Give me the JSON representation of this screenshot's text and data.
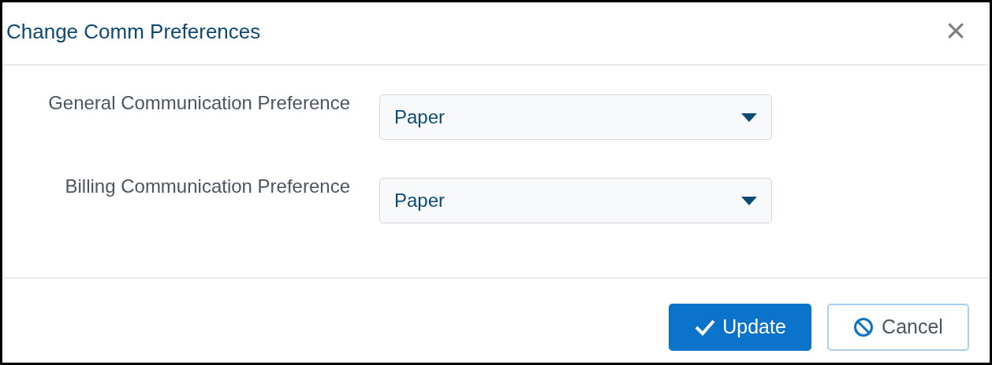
{
  "dialog": {
    "title": "Change Comm Preferences",
    "close": "×"
  },
  "fields": [
    {
      "label": "General Communication Preference",
      "value": "Paper"
    },
    {
      "label": "Billing Communication Preference",
      "value": "Paper"
    }
  ],
  "buttons": [
    {
      "kind": "primary",
      "label": "Update"
    },
    {
      "kind": "secondary",
      "label": "Cancel"
    }
  ]
}
